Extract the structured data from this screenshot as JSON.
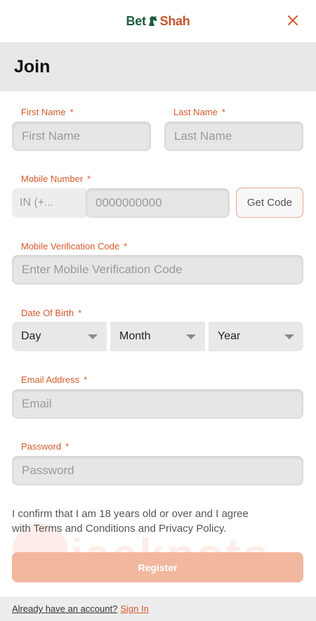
{
  "brand": {
    "part1": "Bet",
    "part2": "Shah"
  },
  "page_title": "Join",
  "fields": {
    "first_name": {
      "label": "First Name",
      "placeholder": "First Name"
    },
    "last_name": {
      "label": "Last Name",
      "placeholder": "Last Name"
    },
    "mobile": {
      "label": "Mobile Number",
      "country_code": "IN (+...",
      "placeholder": "0000000000",
      "get_code": "Get Code"
    },
    "verification": {
      "label": "Mobile Verification Code",
      "placeholder": "Enter Mobile Verification Code"
    },
    "dob": {
      "label": "Date Of Birth",
      "day": "Day",
      "month": "Month",
      "year": "Year"
    },
    "email": {
      "label": "Email Address",
      "placeholder": "Email"
    },
    "password": {
      "label": "Password",
      "placeholder": "Password"
    }
  },
  "required_marker": "*",
  "confirm_text": "I confirm that I am 18 years old or over and I agree with Terms and Conditions and Privacy Policy.",
  "confirm_toggle_on": true,
  "register_label": "Register",
  "watermark_text": "jackpots",
  "footer": {
    "prompt": "Already have an account?",
    "signin": "Sign In"
  },
  "colors": {
    "accent": "#d35a2b",
    "brand_green": "#1c5c3c",
    "toggle_on": "#ee6d39",
    "register_bg": "#f2b79f"
  }
}
